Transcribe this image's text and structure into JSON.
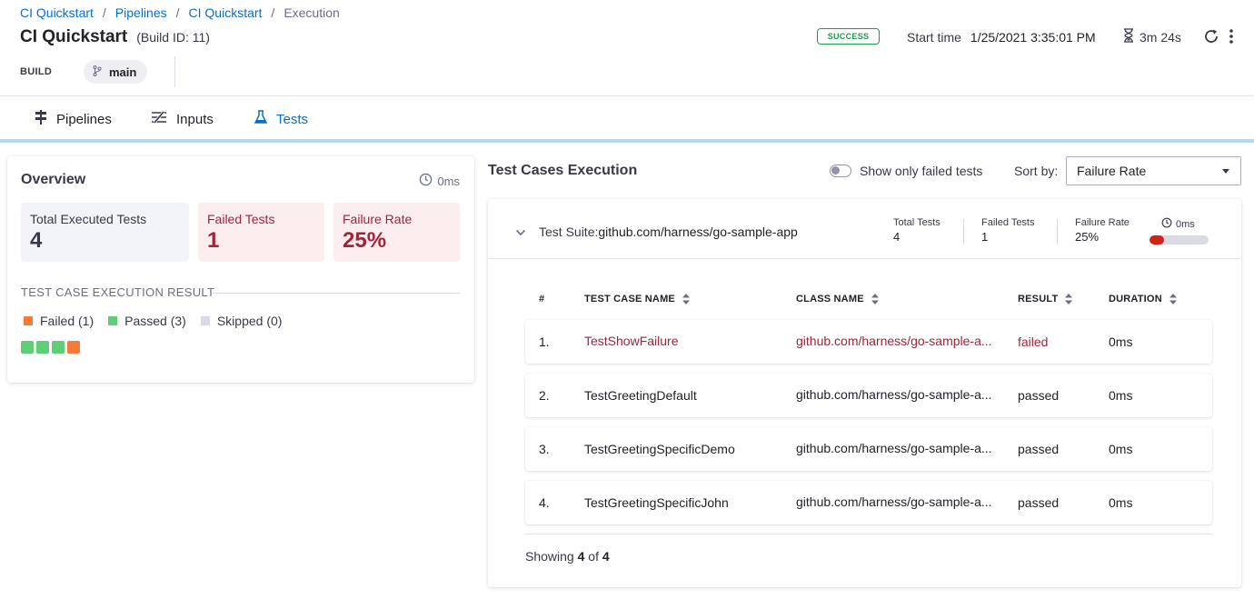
{
  "breadcrumb": {
    "items": [
      "CI Quickstart",
      "Pipelines",
      "CI Quickstart"
    ],
    "current": "Execution",
    "separator": "/"
  },
  "header": {
    "title": "CI Quickstart",
    "build_id": "(Build ID: 11)",
    "build_label": "BUILD",
    "branch": "main",
    "status": "SUCCESS",
    "start_time_label": "Start time",
    "start_time_value": "1/25/2021 3:35:01 PM",
    "duration": "3m 24s"
  },
  "tabs": [
    {
      "label": "Pipelines",
      "icon": "pipeline-icon"
    },
    {
      "label": "Inputs",
      "icon": "inputs-icon"
    },
    {
      "label": "Tests",
      "icon": "flask-icon",
      "active": true
    }
  ],
  "overview": {
    "title": "Overview",
    "time": "0ms",
    "total_label": "Total Executed Tests",
    "total_value": "4",
    "failed_label": "Failed Tests",
    "failed_value": "1",
    "rate_label": "Failure Rate",
    "rate_value": "25%",
    "result_heading": "TEST CASE EXECUTION RESULT",
    "legend": [
      {
        "label": "Failed (1)",
        "color": "#f47b39"
      },
      {
        "label": "Passed (3)",
        "color": "#5fce77"
      },
      {
        "label": "Skipped (0)",
        "color": "#d9dae5"
      }
    ],
    "squares": [
      "#5fce77",
      "#5fce77",
      "#5fce77",
      "#f47b39"
    ]
  },
  "execution": {
    "title": "Test Cases Execution",
    "toggle_label": "Show only failed tests",
    "sort_label": "Sort by:",
    "sort_value": "Failure Rate"
  },
  "suite": {
    "prefix": "Test Suite:",
    "name": "github.com/harness/go-sample-app",
    "total_label": "Total Tests",
    "total_value": "4",
    "failed_label": "Failed Tests",
    "failed_value": "1",
    "rate_label": "Failure Rate",
    "rate_value": "25%",
    "time": "0ms",
    "failure_fraction": 0.25,
    "columns": [
      "#",
      "TEST CASE NAME",
      "CLASS NAME",
      "RESULT",
      "DURATION"
    ],
    "rows": [
      {
        "num": "1.",
        "name": "TestShowFailure",
        "cls": "github.com/harness/go-sample-a...",
        "result": "failed",
        "duration": "0ms"
      },
      {
        "num": "2.",
        "name": "TestGreetingDefault",
        "cls": "github.com/harness/go-sample-a...",
        "result": "passed",
        "duration": "0ms"
      },
      {
        "num": "3.",
        "name": "TestGreetingSpecificDemo",
        "cls": "github.com/harness/go-sample-a...",
        "result": "passed",
        "duration": "0ms"
      },
      {
        "num": "4.",
        "name": "TestGreetingSpecificJohn",
        "cls": "github.com/harness/go-sample-a...",
        "result": "passed",
        "duration": "0ms"
      }
    ],
    "showing_prefix": "Showing",
    "showing_count": "4",
    "showing_of": "of",
    "showing_total": "4"
  }
}
